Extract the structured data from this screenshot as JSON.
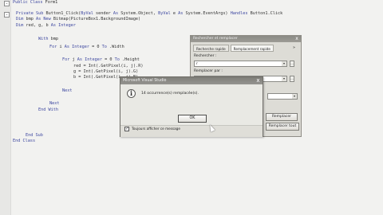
{
  "editor": {
    "lines": [
      "Public Class Form1",
      "Private Sub Button1_Click(ByVal sender As System.Object, ByVal e As System.EventArgs) Handles Button1.Click",
      "Dim bmp As New Bitmap(PictureBox1.BackgroundImage)",
      "Dim red, g, b As Integer",
      "With bmp",
      "For i As Integer = 0 To .Width",
      "For j As Integer = 0 To .Height",
      "red = Int(.GetPixel(i, j).R)",
      "g = Int(.GetPixel(i, j).G)",
      "b = Int(.GetPixel(i, j).B)",
      "Next",
      "Next",
      "End With",
      "End Sub",
      "End Class"
    ],
    "collapse_symbol": "-"
  },
  "find_replace": {
    "title": "Rechercher et remplacer",
    "close_symbol": "x",
    "tabs": [
      "Recherche rapide",
      "Remplacement rapide"
    ],
    "tab_chevron": "»",
    "search_label": "Rechercher :",
    "search_value": "r",
    "replace_label": "Remplacer par :",
    "replace_value": "red",
    "replace_button": "Remplacer",
    "replace_all_button": "Remplacer tout",
    "dropdown_symbol": "▾",
    "small_button": "..."
  },
  "message_box": {
    "title": "Microsoft Visual Studio",
    "close_symbol": "x",
    "icon": "info-icon",
    "icon_glyph": "i",
    "message": "14 occurrence(s) remplacée(s).",
    "ok_label": "OK",
    "checkbox_checked": true,
    "checkbox_mark": "✓",
    "checkbox_label": "Toujours afficher ce message"
  },
  "colors": {
    "keyword": "#3d47a0",
    "title_bar": "#8b8a85",
    "background": "#f2f2f0"
  }
}
